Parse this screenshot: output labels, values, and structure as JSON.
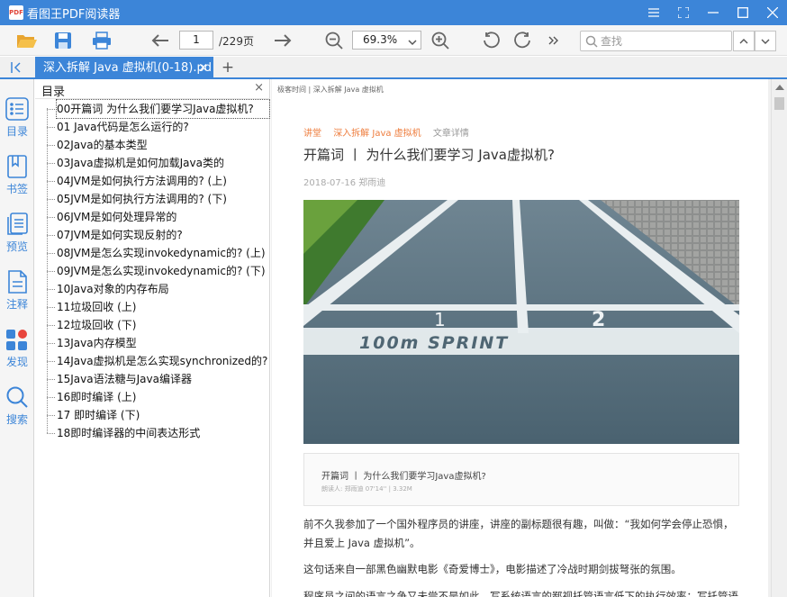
{
  "app": {
    "title": "看图王PDF阅读器",
    "logo_text": "PDF"
  },
  "toolbar": {
    "page_current": "1",
    "page_total": "/229页",
    "zoom": "69.3%",
    "search_placeholder": "查找"
  },
  "tabs": [
    {
      "label": "深入拆解 Java 虚拟机(0-18).pd",
      "close": "×"
    }
  ],
  "add_tab": "+",
  "sidebar_rail": [
    {
      "label": "目录",
      "icon": "list-icon"
    },
    {
      "label": "书签",
      "icon": "bookmark-icon"
    },
    {
      "label": "预览",
      "icon": "preview-icon"
    },
    {
      "label": "注释",
      "icon": "annotation-icon"
    },
    {
      "label": "发现",
      "icon": "discover-icon"
    },
    {
      "label": "搜索",
      "icon": "search-icon"
    }
  ],
  "toc": {
    "title": "目录",
    "close": "×",
    "items": [
      "00开篇词 为什么我们要学习Java虚拟机?",
      "01 Java代码是怎么运行的?",
      "02Java的基本类型",
      "03Java虚拟机是如何加载Java类的",
      "04JVM是如何执行方法调用的? (上)",
      "05JVM是如何执行方法调用的? (下)",
      "06JVM是如何处理异常的",
      "07JVM是如何实现反射的?",
      "08JVM是怎么实现invokedynamic的? (上)",
      "09JVM是怎么实现invokedynamic的? (下)",
      "10Java对象的内存布局",
      "11垃圾回收 (上)",
      "12垃圾回收 (下)",
      "13Java内存模型",
      "14Java虚拟机是怎么实现synchronized的?",
      "15Java语法糖与Java编译器",
      "16即时编译 (上)",
      "17 即时编译 (下)",
      "18即时编译器的中间表达形式"
    ]
  },
  "document": {
    "header": "极客时间 | 深入拆解 Java 虚拟机",
    "breadcrumb": [
      "讲堂",
      "深入拆解 Java 虚拟机",
      "文章详情"
    ],
    "title": "开篇词 丨 为什么我们要学习 Java虚拟机?",
    "meta": "2018-07-16 郑雨迪",
    "hero_text": "100m SPRINT",
    "hero_lane_1": "1",
    "hero_lane_2": "2",
    "audio_title": "开篇词 丨 为什么我们要学习Java虚拟机?",
    "audio_meta": "朗读人:  郑雨迪     07'14''  |  3.32M",
    "paragraphs": [
      "前不久我参加了一个国外程序员的讲座，讲座的副标题很有趣，叫做：“我如何学会停止恐惧，并且爱上 Java 虚拟机”。",
      "这句话来自一部黑色幽默电影《奇爱博士》，电影描述了冷战时期剑拔弩张的氛围。",
      "程序员之间的语言之争又未尝不是如此。写系统语言的鄙视托管语言低下的执行效率；写托管语言"
    ]
  },
  "colors": {
    "accent": "#3c85d8",
    "breadcrumb": "#ee7c3c"
  }
}
